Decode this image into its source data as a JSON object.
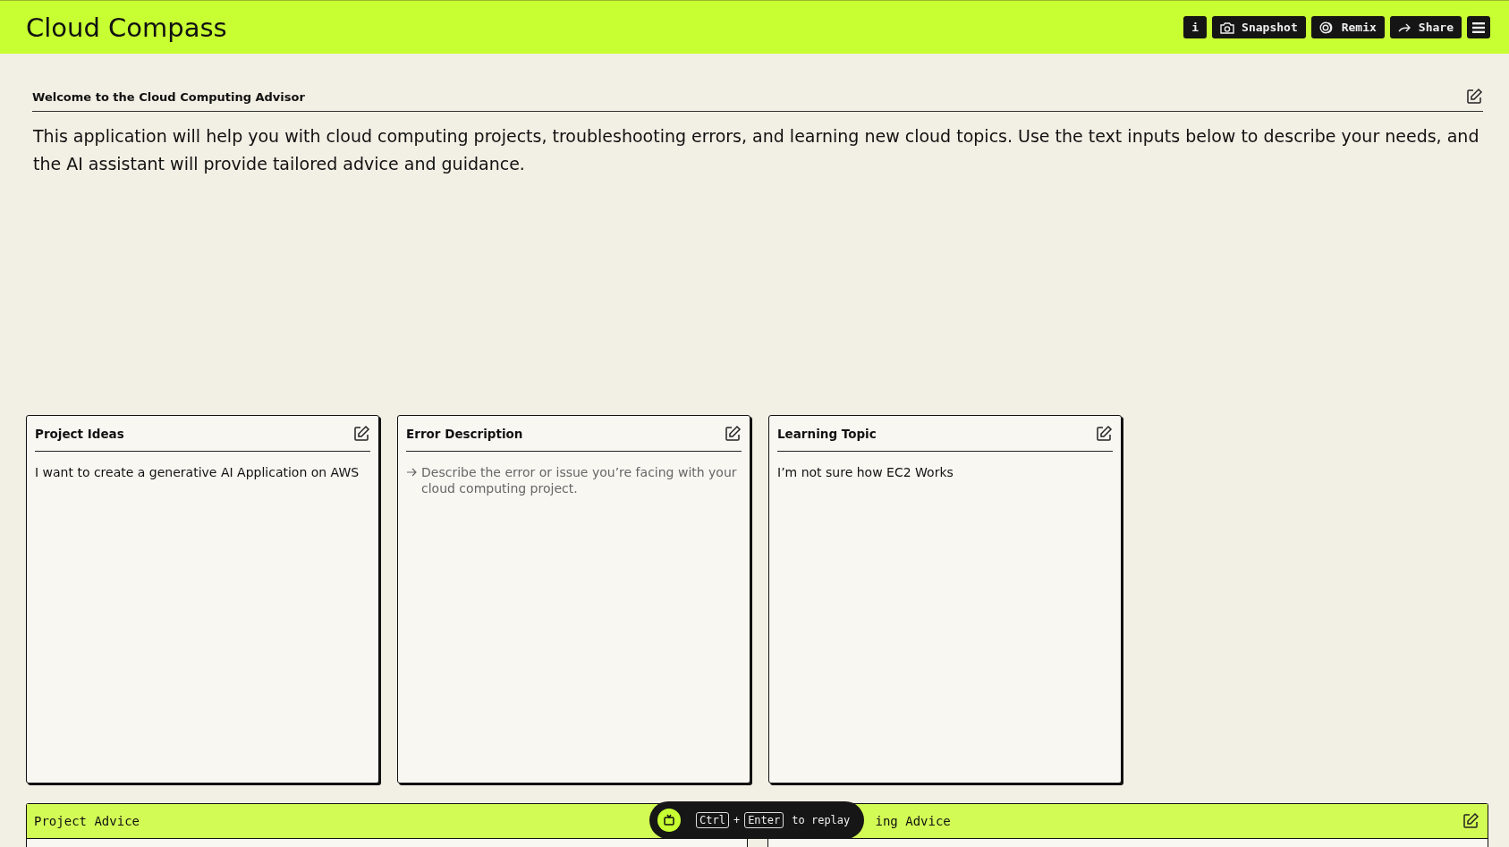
{
  "app": {
    "title": "Cloud Compass"
  },
  "toolbar": [
    {
      "kind": "info",
      "label": "i"
    },
    {
      "kind": "camera",
      "label": "Snapshot"
    },
    {
      "kind": "remix",
      "label": "Remix"
    },
    {
      "kind": "share",
      "label": "Share"
    },
    {
      "kind": "menu"
    }
  ],
  "intro": {
    "title": "Welcome to the Cloud Computing Advisor",
    "text": "This application will help you with cloud computing projects, troubleshooting errors, and learning new cloud topics. Use the text inputs below to describe your needs, and the AI assistant will provide tailored advice and guidance."
  },
  "inputs": [
    {
      "title": "Project Ideas",
      "value": "I want to create a generative AI Application on AWS"
    },
    {
      "title": "Error Description",
      "placeholder": "Describe the error or issue you’re facing with your cloud computing project."
    },
    {
      "title": "Learning Topic",
      "value": "I’m not sure how EC2 Works"
    }
  ],
  "outputs": [
    {
      "title": "Project Advice"
    },
    {
      "title": "ing Advice"
    }
  ],
  "replay_hint": {
    "keys": [
      "Ctrl",
      "Enter"
    ],
    "joiner": "+",
    "text": "to replay"
  }
}
